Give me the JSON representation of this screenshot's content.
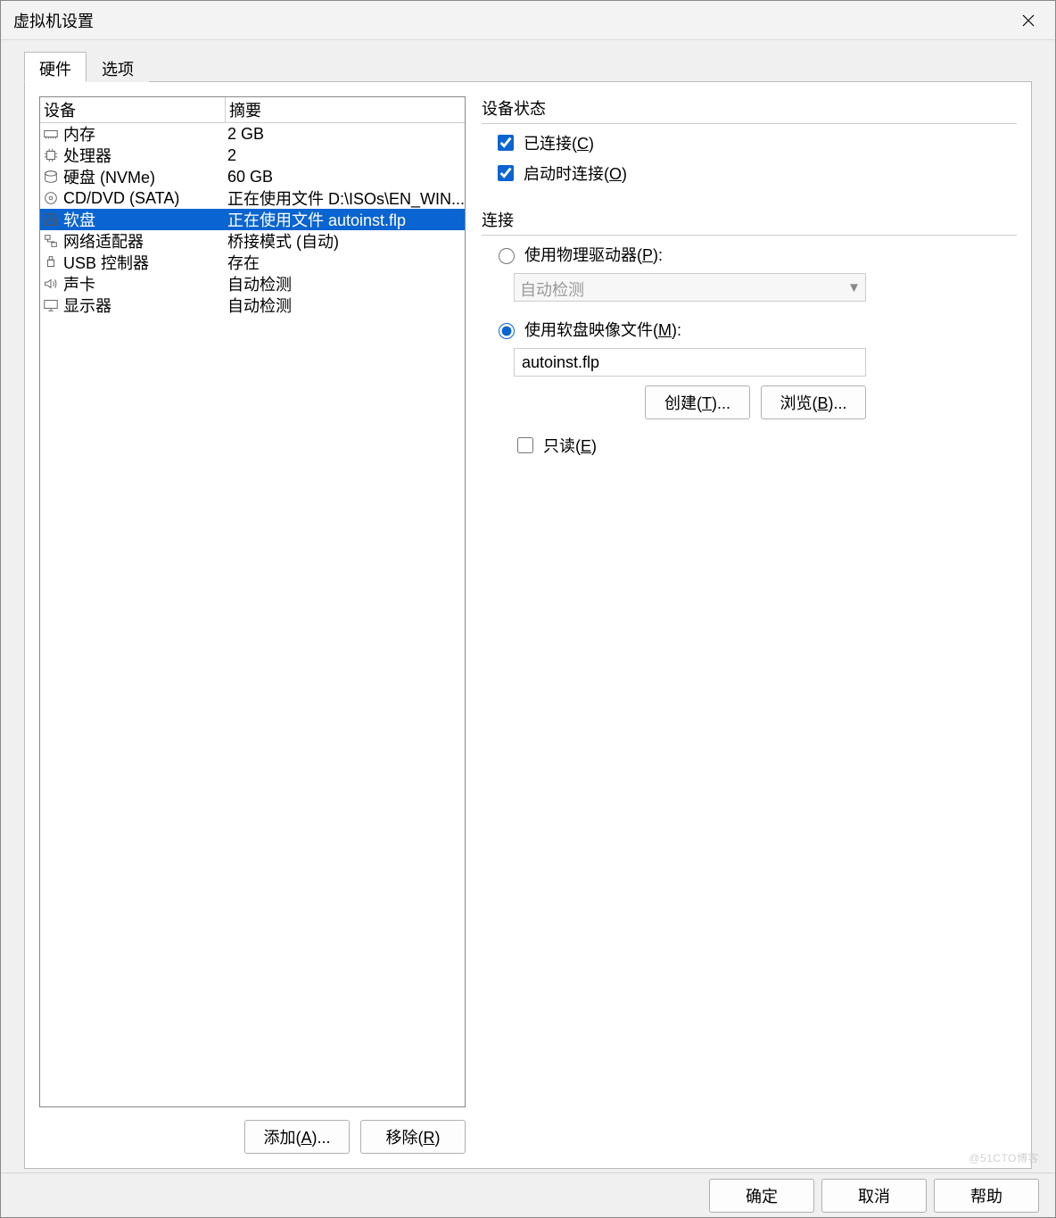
{
  "title": "虚拟机设置",
  "tabs": {
    "hardware": "硬件",
    "options": "选项"
  },
  "device_header": {
    "device": "设备",
    "summary": "摘要"
  },
  "devices": [
    {
      "icon": "memory-icon",
      "name": "内存",
      "summary": "2 GB",
      "selected": false
    },
    {
      "icon": "cpu-icon",
      "name": "处理器",
      "summary": "2",
      "selected": false
    },
    {
      "icon": "disk-icon",
      "name": "硬盘 (NVMe)",
      "summary": "60 GB",
      "selected": false
    },
    {
      "icon": "cd-icon",
      "name": "CD/DVD (SATA)",
      "summary": "正在使用文件 D:\\ISOs\\EN_WIN...",
      "selected": false
    },
    {
      "icon": "floppy-icon",
      "name": "软盘",
      "summary": "正在使用文件 autoinst.flp",
      "selected": true
    },
    {
      "icon": "network-icon",
      "name": "网络适配器",
      "summary": "桥接模式 (自动)",
      "selected": false
    },
    {
      "icon": "usb-icon",
      "name": "USB 控制器",
      "summary": "存在",
      "selected": false
    },
    {
      "icon": "sound-icon",
      "name": "声卡",
      "summary": "自动检测",
      "selected": false
    },
    {
      "icon": "display-icon",
      "name": "显示器",
      "summary": "自动检测",
      "selected": false
    }
  ],
  "left_buttons": {
    "add": "添加(A)...",
    "remove": "移除(R)"
  },
  "right": {
    "status_title": "设备状态",
    "connected": {
      "label": "已连接(C)",
      "checked": true
    },
    "connect_at_power": {
      "label": "启动时连接(O)",
      "checked": true
    },
    "connection_title": "连接",
    "use_physical": {
      "label": "使用物理驱动器(P):",
      "selected": false
    },
    "physical_combo": "自动检测",
    "use_image": {
      "label": "使用软盘映像文件(M):",
      "selected": true
    },
    "image_path": "autoinst.flp",
    "create": "创建(T)...",
    "browse": "浏览(B)...",
    "readonly": {
      "label": "只读(E)",
      "checked": false
    }
  },
  "actions": {
    "ok": "确定",
    "cancel": "取消",
    "help": "帮助"
  },
  "watermark": "@51CTO博客"
}
